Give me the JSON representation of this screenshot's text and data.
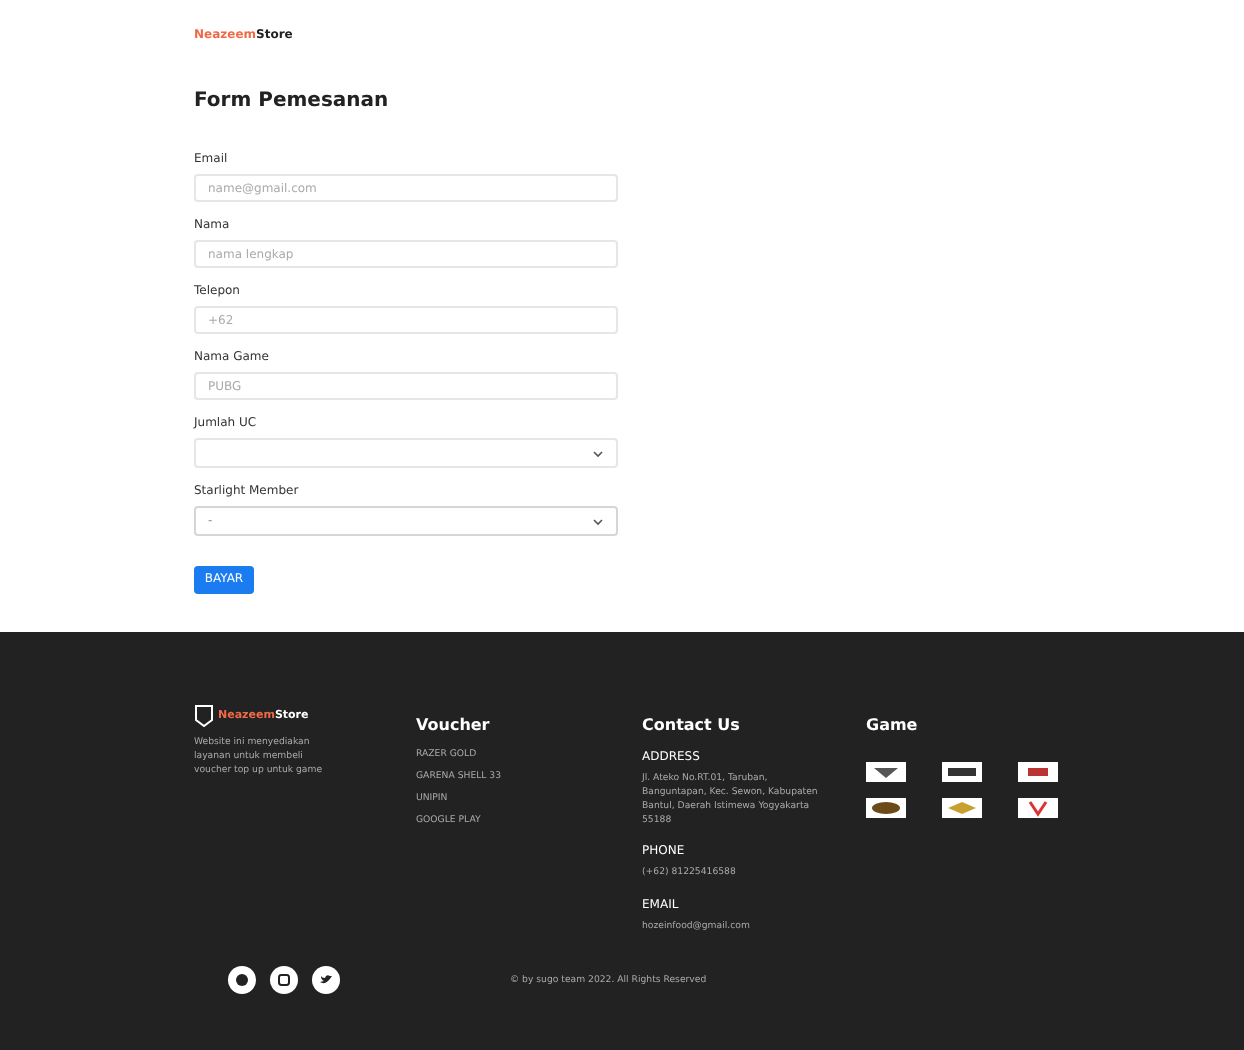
{
  "header": {
    "brand_accent": "Neazeem",
    "brand": "Store"
  },
  "form": {
    "title": "Form Pemesanan",
    "fields": [
      {
        "kind": "input",
        "label": "Email",
        "placeholder": "name@gmail.com"
      },
      {
        "kind": "input",
        "label": "Nama",
        "placeholder": "nama lengkap"
      },
      {
        "kind": "input",
        "label": "Telepon",
        "placeholder": "+62"
      },
      {
        "kind": "input",
        "label": "Nama Game",
        "placeholder": "PUBG"
      },
      {
        "kind": "select",
        "label": "Jumlah UC"
      },
      {
        "kind": "select",
        "label": "Starlight  Member",
        "value": "-"
      }
    ],
    "submit": "BAYAR"
  },
  "footer": {
    "brand_accent": "Neazeem",
    "brand": "Store",
    "about": "Website ini menyediakan layanan untuk membeli voucher top up untuk game",
    "voucher": {
      "title": "Voucher",
      "links": [
        "RAZER GOLD",
        "GARENA SHELL 33",
        "UNIPIN",
        "GOOGLE PLAY"
      ]
    },
    "contact": {
      "title": "Contact Us",
      "sections": [
        {
          "heading": "ADDRESS",
          "text": "Jl. Ateko No.RT.01, Taruban, Banguntapan, Kec. Sewon, Kabupaten Bantul, Daerah Istimewa Yogyakarta 55188"
        },
        {
          "heading": "PHONE",
          "text": "(+62) 81225416588"
        },
        {
          "heading": "EMAIL",
          "text": "hozeinfood@gmail.com"
        }
      ]
    },
    "game": {
      "title": "Game"
    },
    "copyright": "© by sugo team 2022. All Rights Reserved"
  }
}
